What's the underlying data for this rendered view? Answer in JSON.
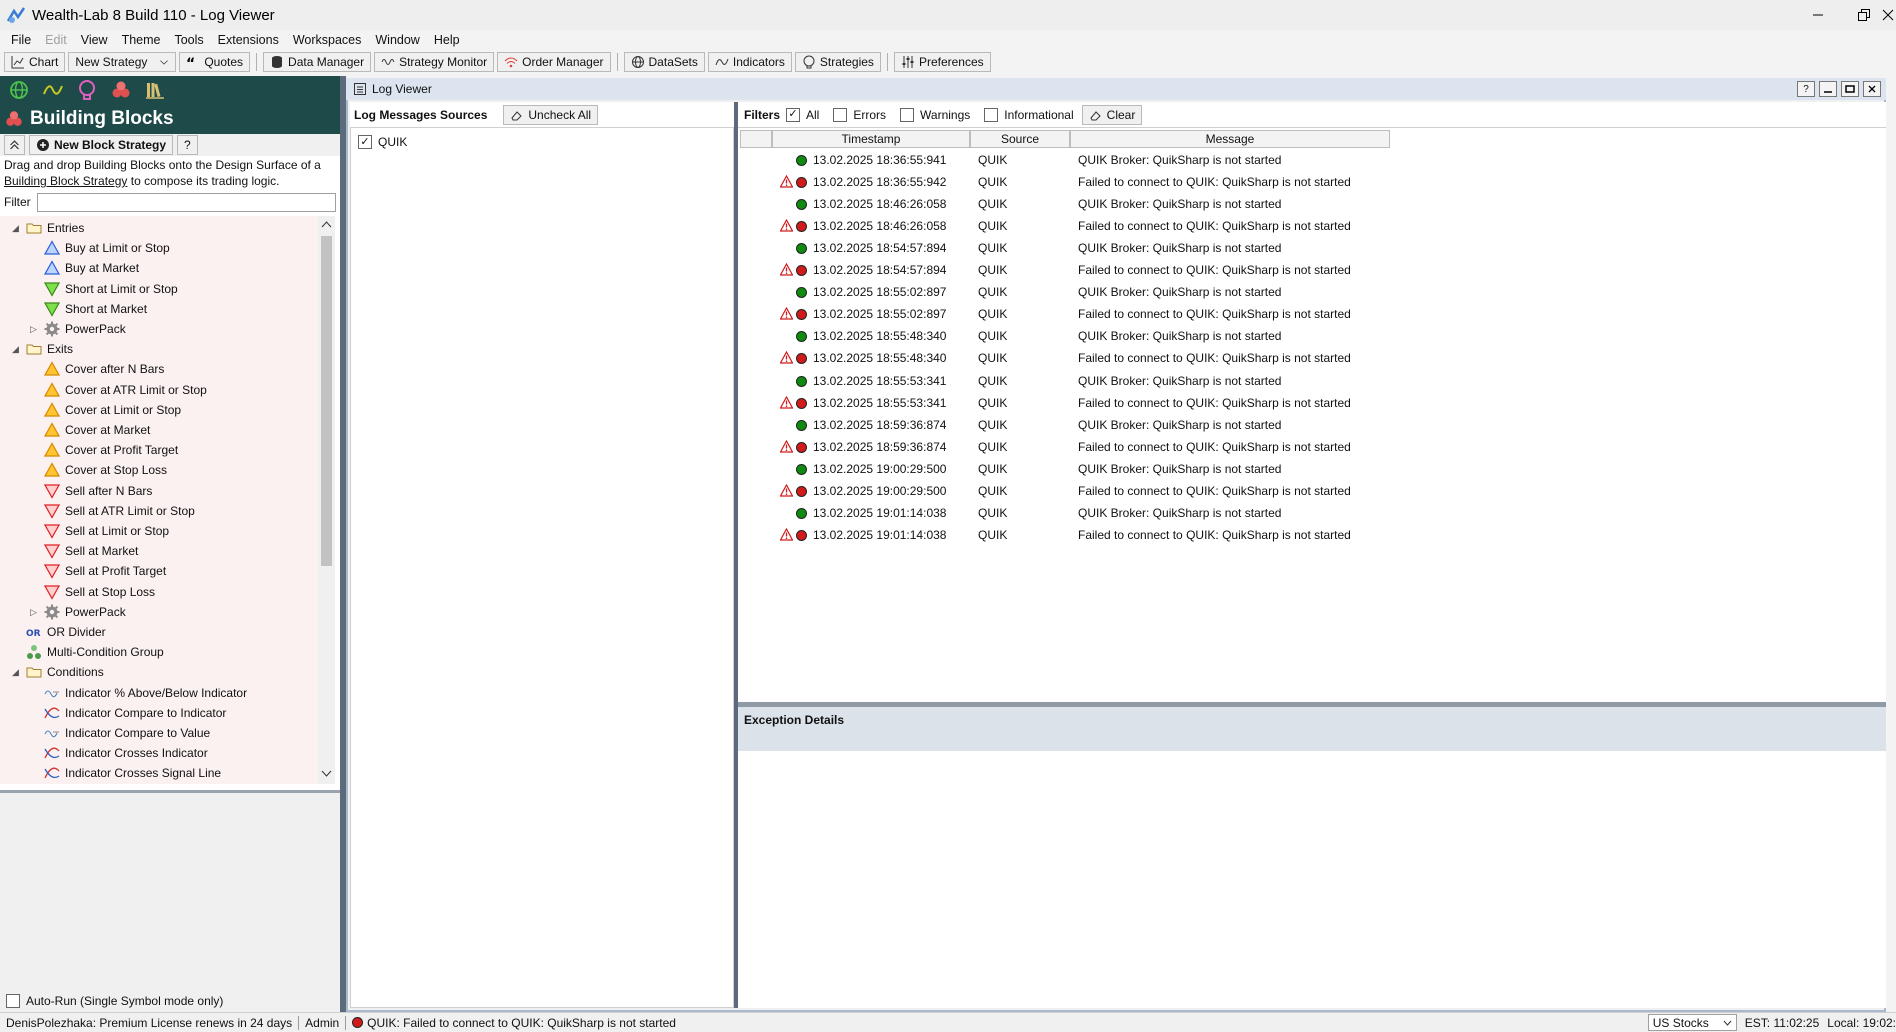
{
  "window": {
    "title": "Wealth-Lab 8 Build 110 - Log Viewer"
  },
  "menu": [
    "File",
    "Edit",
    "View",
    "Theme",
    "Tools",
    "Extensions",
    "Workspaces",
    "Window",
    "Help"
  ],
  "toolbar": {
    "chart": "Chart",
    "new_strategy": "New Strategy",
    "quotes": "Quotes",
    "data_manager": "Data Manager",
    "strategy_monitor": "Strategy Monitor",
    "order_manager": "Order Manager",
    "datasets": "DataSets",
    "indicators": "Indicators",
    "strategies": "Strategies",
    "preferences": "Preferences"
  },
  "building_blocks": {
    "title": "Building Blocks",
    "new_block_strategy": "New Block Strategy",
    "help": "?",
    "description_1": "Drag and drop Building Blocks onto the Design Surface of a",
    "description_link": "Building Block Strategy",
    "description_2": " to compose its trading logic.",
    "filter_label": "Filter",
    "tree": {
      "entries": "Entries",
      "entries_items": [
        "Buy at Limit or Stop",
        "Buy at Market",
        "Short at Limit or Stop",
        "Short at Market"
      ],
      "powerpack1": "PowerPack",
      "exits": "Exits",
      "exits_orange": [
        "Cover after N Bars",
        "Cover at ATR Limit or Stop",
        "Cover at Limit or Stop",
        "Cover at Market",
        "Cover at Profit Target",
        "Cover at Stop Loss"
      ],
      "exits_red": [
        "Sell after N Bars",
        "Sell at ATR Limit or Stop",
        "Sell at Limit or Stop",
        "Sell at Market",
        "Sell at Profit Target",
        "Sell at Stop Loss"
      ],
      "powerpack2": "PowerPack",
      "or_divider": "OR Divider",
      "multi_condition": "Multi-Condition Group",
      "conditions": "Conditions",
      "conditions_items": [
        "Indicator % Above/Below Indicator",
        "Indicator Compare to Indicator",
        "Indicator Compare to Value",
        "Indicator Crosses Indicator",
        "Indicator Crosses Signal Line"
      ]
    },
    "autorun": "Auto-Run (Single Symbol mode only)"
  },
  "log_viewer": {
    "title": "Log Viewer",
    "sources_label": "Log Messages Sources",
    "uncheck_all": "Uncheck All",
    "source_item": "QUIK",
    "filters_label": "Filters",
    "filter_all": "All",
    "filter_errors": "Errors",
    "filter_warnings": "Warnings",
    "filter_info": "Informational",
    "clear": "Clear",
    "columns": [
      "Timestamp",
      "Source",
      "Message"
    ],
    "rows": [
      {
        "warn": false,
        "status": "ok",
        "ts": "13.02.2025 18:36:55:941",
        "src": "QUIK",
        "msg": "QUIK Broker: QuikSharp is not started"
      },
      {
        "warn": true,
        "status": "err",
        "ts": "13.02.2025 18:36:55:942",
        "src": "QUIK",
        "msg": "Failed to connect to QUIK: QuikSharp is not started"
      },
      {
        "warn": false,
        "status": "ok",
        "ts": "13.02.2025 18:46:26:058",
        "src": "QUIK",
        "msg": "QUIK Broker: QuikSharp is not started"
      },
      {
        "warn": true,
        "status": "err",
        "ts": "13.02.2025 18:46:26:058",
        "src": "QUIK",
        "msg": "Failed to connect to QUIK: QuikSharp is not started"
      },
      {
        "warn": false,
        "status": "ok",
        "ts": "13.02.2025 18:54:57:894",
        "src": "QUIK",
        "msg": "QUIK Broker: QuikSharp is not started"
      },
      {
        "warn": true,
        "status": "err",
        "ts": "13.02.2025 18:54:57:894",
        "src": "QUIK",
        "msg": "Failed to connect to QUIK: QuikSharp is not started"
      },
      {
        "warn": false,
        "status": "ok",
        "ts": "13.02.2025 18:55:02:897",
        "src": "QUIK",
        "msg": "QUIK Broker: QuikSharp is not started"
      },
      {
        "warn": true,
        "status": "err",
        "ts": "13.02.2025 18:55:02:897",
        "src": "QUIK",
        "msg": "Failed to connect to QUIK: QuikSharp is not started"
      },
      {
        "warn": false,
        "status": "ok",
        "ts": "13.02.2025 18:55:48:340",
        "src": "QUIK",
        "msg": "QUIK Broker: QuikSharp is not started"
      },
      {
        "warn": true,
        "status": "err",
        "ts": "13.02.2025 18:55:48:340",
        "src": "QUIK",
        "msg": "Failed to connect to QUIK: QuikSharp is not started"
      },
      {
        "warn": false,
        "status": "ok",
        "ts": "13.02.2025 18:55:53:341",
        "src": "QUIK",
        "msg": "QUIK Broker: QuikSharp is not started"
      },
      {
        "warn": true,
        "status": "err",
        "ts": "13.02.2025 18:55:53:341",
        "src": "QUIK",
        "msg": "Failed to connect to QUIK: QuikSharp is not started"
      },
      {
        "warn": false,
        "status": "ok",
        "ts": "13.02.2025 18:59:36:874",
        "src": "QUIK",
        "msg": "QUIK Broker: QuikSharp is not started"
      },
      {
        "warn": true,
        "status": "err",
        "ts": "13.02.2025 18:59:36:874",
        "src": "QUIK",
        "msg": "Failed to connect to QUIK: QuikSharp is not started"
      },
      {
        "warn": false,
        "status": "ok",
        "ts": "13.02.2025 19:00:29:500",
        "src": "QUIK",
        "msg": "QUIK Broker: QuikSharp is not started"
      },
      {
        "warn": true,
        "status": "err",
        "ts": "13.02.2025 19:00:29:500",
        "src": "QUIK",
        "msg": "Failed to connect to QUIK: QuikSharp is not started"
      },
      {
        "warn": false,
        "status": "ok",
        "ts": "13.02.2025 19:01:14:038",
        "src": "QUIK",
        "msg": "QUIK Broker: QuikSharp is not started"
      },
      {
        "warn": true,
        "status": "err",
        "ts": "13.02.2025 19:01:14:038",
        "src": "QUIK",
        "msg": "Failed to connect to QUIK: QuikSharp is not started"
      }
    ],
    "exception_details": "Exception Details"
  },
  "statusbar": {
    "license": "DenisPolezhaka: Premium License renews in 24 days",
    "user": "Admin",
    "message": "QUIK: Failed to connect to QUIK: QuikSharp is not started",
    "market": "US Stocks",
    "est": "EST: 11:02:25",
    "local": "Local: 19:02:"
  },
  "colors": {
    "ok": "#0e8a0e",
    "err": "#d11a1a",
    "panel_dark": "#1f4a4a",
    "splitter": "#5b6b7c"
  }
}
